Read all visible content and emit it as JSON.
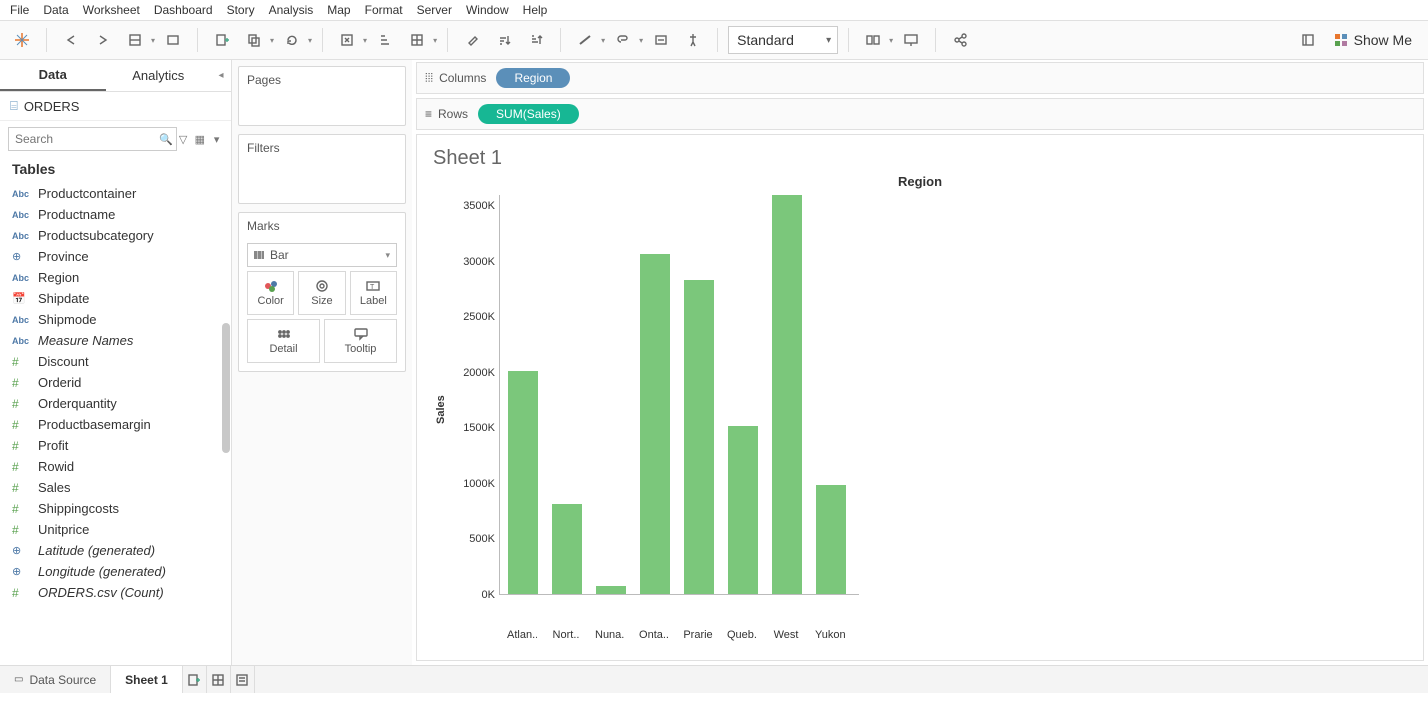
{
  "menu": [
    "File",
    "Data",
    "Worksheet",
    "Dashboard",
    "Story",
    "Analysis",
    "Map",
    "Format",
    "Server",
    "Window",
    "Help"
  ],
  "toolbar": {
    "fit": "Standard",
    "show_me": "Show Me"
  },
  "left": {
    "tabs": {
      "data": "Data",
      "analytics": "Analytics"
    },
    "source": "ORDERS",
    "search_placeholder": "Search",
    "tables_heading": "Tables",
    "fields": [
      {
        "icon": "abc",
        "label": "Productcontainer",
        "cls": "dim-text"
      },
      {
        "icon": "abc",
        "label": "Productname",
        "cls": "dim-text"
      },
      {
        "icon": "abc",
        "label": "Productsubcategory",
        "cls": "dim-text"
      },
      {
        "icon": "geo",
        "label": "Province",
        "cls": "dim-text"
      },
      {
        "icon": "abc",
        "label": "Region",
        "cls": "dim-text"
      },
      {
        "icon": "date",
        "label": "Shipdate",
        "cls": "dim-text"
      },
      {
        "icon": "abc",
        "label": "Shipmode",
        "cls": "dim-text"
      },
      {
        "icon": "abc",
        "label": "Measure Names",
        "cls": "dim-text italic"
      },
      {
        "icon": "num",
        "label": "Discount",
        "cls": "mea-text"
      },
      {
        "icon": "num",
        "label": "Orderid",
        "cls": "mea-text"
      },
      {
        "icon": "num",
        "label": "Orderquantity",
        "cls": "mea-text"
      },
      {
        "icon": "num",
        "label": "Productbasemargin",
        "cls": "mea-text"
      },
      {
        "icon": "num",
        "label": "Profit",
        "cls": "mea-text"
      },
      {
        "icon": "num",
        "label": "Rowid",
        "cls": "mea-text"
      },
      {
        "icon": "num",
        "label": "Sales",
        "cls": "mea-text"
      },
      {
        "icon": "num",
        "label": "Shippingcosts",
        "cls": "mea-text"
      },
      {
        "icon": "num",
        "label": "Unitprice",
        "cls": "mea-text"
      },
      {
        "icon": "geo",
        "label": "Latitude (generated)",
        "cls": "mea-text italic"
      },
      {
        "icon": "geo",
        "label": "Longitude (generated)",
        "cls": "mea-text italic"
      },
      {
        "icon": "num",
        "label": "ORDERS.csv (Count)",
        "cls": "mea-text italic"
      }
    ]
  },
  "cards": {
    "pages": "Pages",
    "filters": "Filters",
    "marks": "Marks",
    "mark_type": "Bar",
    "color": "Color",
    "size": "Size",
    "label": "Label",
    "detail": "Detail",
    "tooltip": "Tooltip"
  },
  "shelves": {
    "columns": "Columns",
    "rows": "Rows",
    "col_pill": "Region",
    "row_pill": "SUM(Sales)"
  },
  "viz": {
    "sheet_title": "Sheet 1",
    "ylabel": "Sales"
  },
  "bottom": {
    "data_source": "Data Source",
    "sheet": "Sheet 1"
  },
  "status_text": "",
  "chart_data": {
    "type": "bar",
    "title": "Region",
    "xlabel": "",
    "ylabel": "Sales",
    "ylim": [
      0,
      3600000
    ],
    "yticks": [
      "0K",
      "500K",
      "1000K",
      "1500K",
      "2000K",
      "2500K",
      "3000K",
      "3500K"
    ],
    "categories": [
      "Atlan..",
      "Nort..",
      "Nuna..",
      "Onta..",
      "Prarie",
      "Queb..",
      "West",
      "Yukon"
    ],
    "values": [
      2010000,
      810000,
      70000,
      3060000,
      2830000,
      1510000,
      3590000,
      980000
    ]
  }
}
